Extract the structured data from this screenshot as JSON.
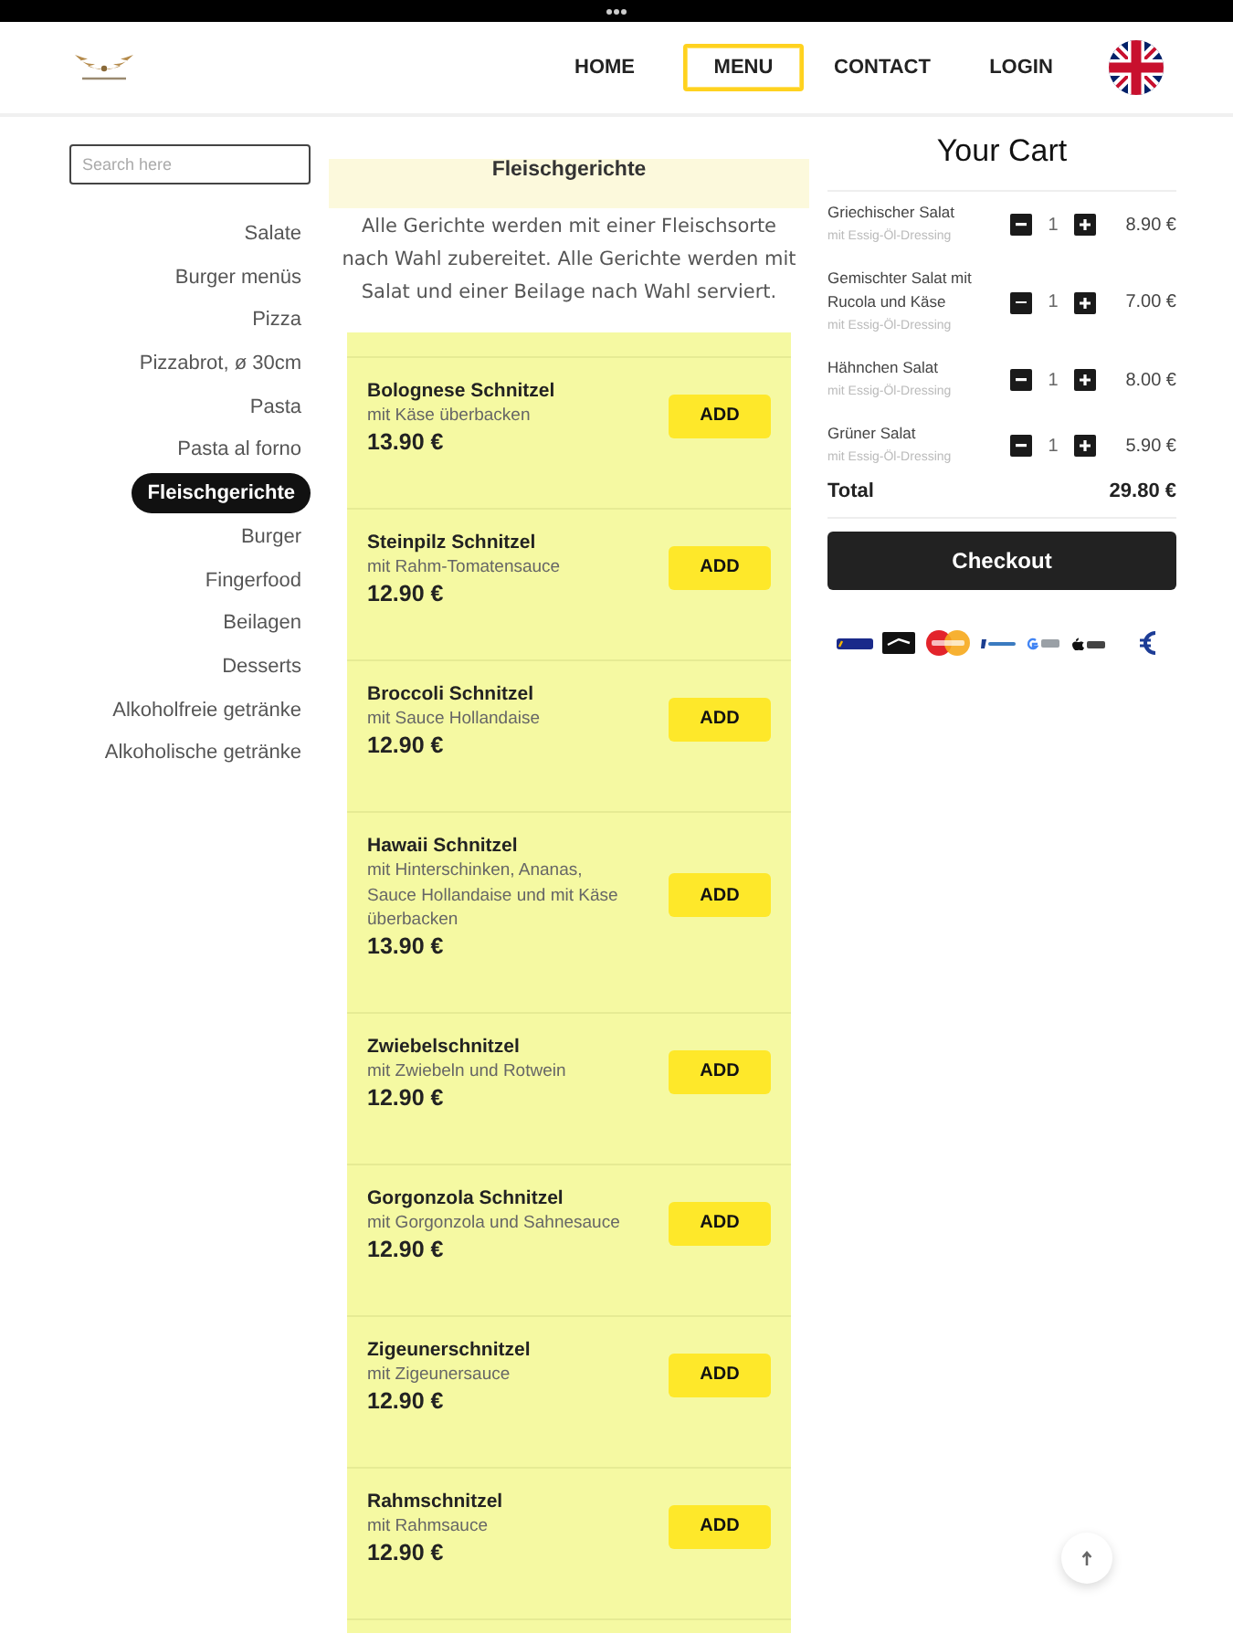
{
  "header": {
    "nav": [
      {
        "label": "HOME",
        "selected": false
      },
      {
        "label": "MENU",
        "selected": true
      },
      {
        "label": "CONTACT",
        "selected": false
      },
      {
        "label": "LOGIN",
        "selected": false
      }
    ]
  },
  "sidebar": {
    "search": {
      "placeholder": "Search here"
    },
    "categories": [
      {
        "label": "Salate",
        "selected": false
      },
      {
        "label": "Burger menüs",
        "selected": false
      },
      {
        "label": "Pizza",
        "selected": false
      },
      {
        "label": "Pizzabrot, ø 30cm",
        "selected": false
      },
      {
        "label": "Pasta",
        "selected": false
      },
      {
        "label": "Pasta al forno",
        "selected": false
      },
      {
        "label": "Fleischgerichte",
        "selected": true
      },
      {
        "label": "Burger",
        "selected": false
      },
      {
        "label": "Fingerfood",
        "selected": false
      },
      {
        "label": "Beilagen",
        "selected": false
      },
      {
        "label": "Desserts",
        "selected": false
      },
      {
        "label": "Alkoholfreie getränke",
        "selected": false
      },
      {
        "label": "Alkoholische getränke",
        "selected": false
      }
    ]
  },
  "menu": {
    "title": "Fleischgerichte",
    "description": "Alle Gerichte werden mit einer Fleischsorte nach Wahl zubereitet. Alle Gerichte werden mit Salat und einer Beilage nach Wahl serviert.",
    "items": [
      {
        "name": "Bolognese Schnitzel",
        "description": "mit Käse überbacken",
        "price": "13.90 €",
        "button": "ADD"
      },
      {
        "name": "Steinpilz Schnitzel",
        "description": "mit Rahm-Tomatensauce",
        "price": "12.90 €",
        "button": "ADD"
      },
      {
        "name": "Broccoli Schnitzel",
        "description": "mit Sauce Hollandaise",
        "price": "12.90 €",
        "button": "ADD"
      },
      {
        "name": "Hawaii Schnitzel",
        "description": "mit Hinterschinken, Ananas, Sauce Hollandaise und mit Käse überbacken",
        "price": "13.90 €",
        "button": "ADD"
      },
      {
        "name": "Zwiebelschnitzel",
        "description": "mit Zwiebeln und Rotwein",
        "price": "12.90 €",
        "button": "ADD"
      },
      {
        "name": "Gorgonzola Schnitzel",
        "description": "mit Gorgonzola und Sahnesauce",
        "price": "12.90 €",
        "button": "ADD"
      },
      {
        "name": "Zigeunerschnitzel",
        "description": "mit Zigeunersauce",
        "price": "12.90 €",
        "button": "ADD"
      },
      {
        "name": "Rahmschnitzel",
        "description": "mit Rahmsauce",
        "price": "12.90 €",
        "button": "ADD"
      }
    ]
  },
  "cart": {
    "title": "Your Cart",
    "items": [
      {
        "name": "Griechischer Salat",
        "note": "mit Essig-Öl-Dressing",
        "quantity": "1",
        "price": "8.90 €"
      },
      {
        "name": "Gemischter Salat mit Rucola und Käse",
        "note": "mit Essig-Öl-Dressing",
        "quantity": "1",
        "price": "7.00 €"
      },
      {
        "name": "Hähnchen Salat",
        "note": "mit Essig-Öl-Dressing",
        "quantity": "1",
        "price": "8.00 €"
      },
      {
        "name": "Grüner Salat",
        "note": "mit Essig-Öl-Dressing",
        "quantity": "1",
        "price": "5.90 €"
      }
    ],
    "total_label": "Total",
    "total": "29.80 €",
    "checkout": "Checkout"
  }
}
